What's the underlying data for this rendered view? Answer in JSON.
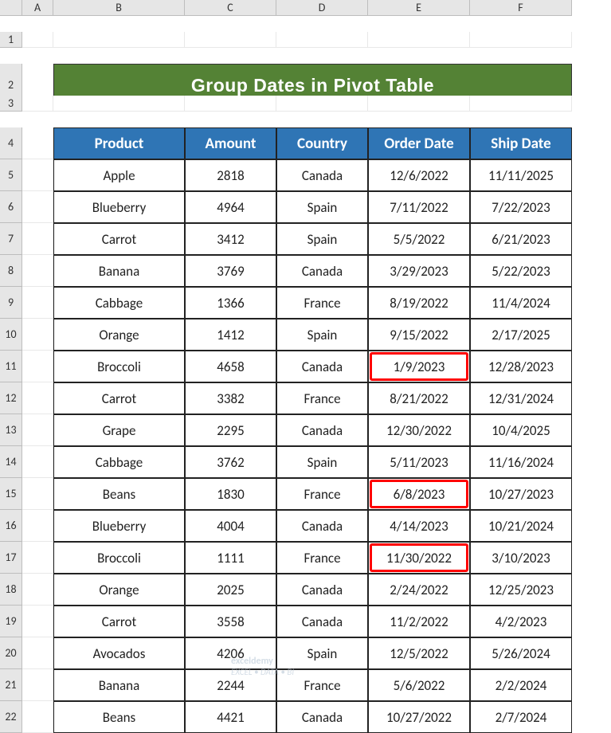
{
  "columns": [
    "A",
    "B",
    "C",
    "D",
    "E",
    "F"
  ],
  "rows": [
    "1",
    "2",
    "3",
    "4",
    "5",
    "6",
    "7",
    "8",
    "9",
    "10",
    "11",
    "12",
    "13",
    "14",
    "15",
    "16",
    "17",
    "18",
    "19",
    "20",
    "21",
    "22"
  ],
  "title": "Group Dates in Pivot Table",
  "headers": [
    "Product",
    "Amount",
    "Country",
    "Order Date",
    "Ship Date"
  ],
  "data": [
    {
      "p": "Apple",
      "a": "2818",
      "c": "Canada",
      "o": "12/6/2022",
      "s": "11/11/2025"
    },
    {
      "p": "Blueberry",
      "a": "4964",
      "c": "Spain",
      "o": "7/11/2022",
      "s": "7/22/2023"
    },
    {
      "p": "Carrot",
      "a": "3412",
      "c": "Spain",
      "o": "5/5/2022",
      "s": "6/21/2023"
    },
    {
      "p": "Banana",
      "a": "3769",
      "c": "Canada",
      "o": "3/29/2023",
      "s": "5/22/2023"
    },
    {
      "p": "Cabbage",
      "a": "1366",
      "c": "France",
      "o": "8/19/2022",
      "s": "11/4/2024"
    },
    {
      "p": "Orange",
      "a": "1412",
      "c": "Spain",
      "o": "9/15/2022",
      "s": "2/17/2025"
    },
    {
      "p": "Broccoli",
      "a": "4658",
      "c": "Canada",
      "o": "1/9/2023",
      "s": "12/28/2023",
      "hl": true
    },
    {
      "p": "Carrot",
      "a": "3382",
      "c": "France",
      "o": "8/21/2022",
      "s": "12/31/2024"
    },
    {
      "p": "Grape",
      "a": "2295",
      "c": "Canada",
      "o": "12/30/2022",
      "s": "10/4/2025"
    },
    {
      "p": "Cabbage",
      "a": "3762",
      "c": "Spain",
      "o": "5/11/2023",
      "s": "11/16/2024"
    },
    {
      "p": "Beans",
      "a": "1830",
      "c": "France",
      "o": "6/8/2023",
      "s": "10/27/2023",
      "hl": true
    },
    {
      "p": "Blueberry",
      "a": "4004",
      "c": "Canada",
      "o": "4/14/2023",
      "s": "10/21/2024"
    },
    {
      "p": "Broccoli",
      "a": "1111",
      "c": "France",
      "o": "11/30/2022",
      "s": "3/10/2023",
      "hl": true
    },
    {
      "p": "Orange",
      "a": "2025",
      "c": "Canada",
      "o": "2/24/2022",
      "s": "12/25/2023"
    },
    {
      "p": "Carrot",
      "a": "3558",
      "c": "Canada",
      "o": "11/2/2022",
      "s": "4/2/2023"
    },
    {
      "p": "Avocados",
      "a": "4206",
      "c": "Spain",
      "o": "12/5/2022",
      "s": "5/26/2024"
    },
    {
      "p": "Banana",
      "a": "2244",
      "c": "France",
      "o": "5/6/2022",
      "s": "2/2/2024"
    },
    {
      "p": "Beans",
      "a": "4421",
      "c": "Canada",
      "o": "10/27/2022",
      "s": "2/7/2024"
    }
  ],
  "watermark": {
    "brand": "exceldemy",
    "tag": "EXCEL • DATA • BI"
  }
}
